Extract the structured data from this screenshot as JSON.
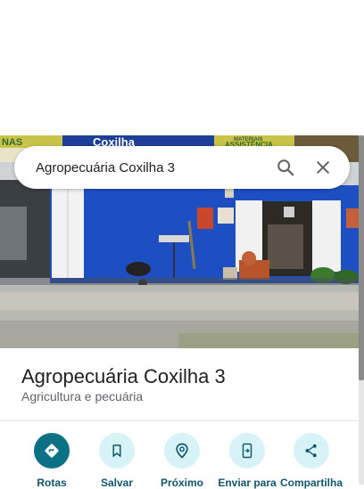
{
  "search": {
    "query": "Agropecuária Coxilha 3",
    "search_icon": "search-icon",
    "close_icon": "close-icon"
  },
  "photo": {
    "signs": {
      "left_fragment": "NAS",
      "center": "Coxilha",
      "right_line_1": "MATERIAIS",
      "right_line_2": "ASSISTÊNCIA"
    }
  },
  "place": {
    "name": "Agropecuária Coxilha 3",
    "category": "Agricultura e pecuária"
  },
  "actions": [
    {
      "label": "Rotas",
      "icon": "directions-icon"
    },
    {
      "label": "Salvar",
      "icon": "bookmark-icon"
    },
    {
      "label": "Próximo",
      "icon": "nearby-icon"
    },
    {
      "label": "Enviar para",
      "icon": "send-to-phone-icon"
    },
    {
      "label": "Compartilha",
      "icon": "share-icon"
    }
  ],
  "colors": {
    "primary_action": "#0b7285",
    "secondary_action_bg": "#d7f3f8",
    "action_label": "#12566b",
    "wall_blue": "#1e4fc2"
  }
}
